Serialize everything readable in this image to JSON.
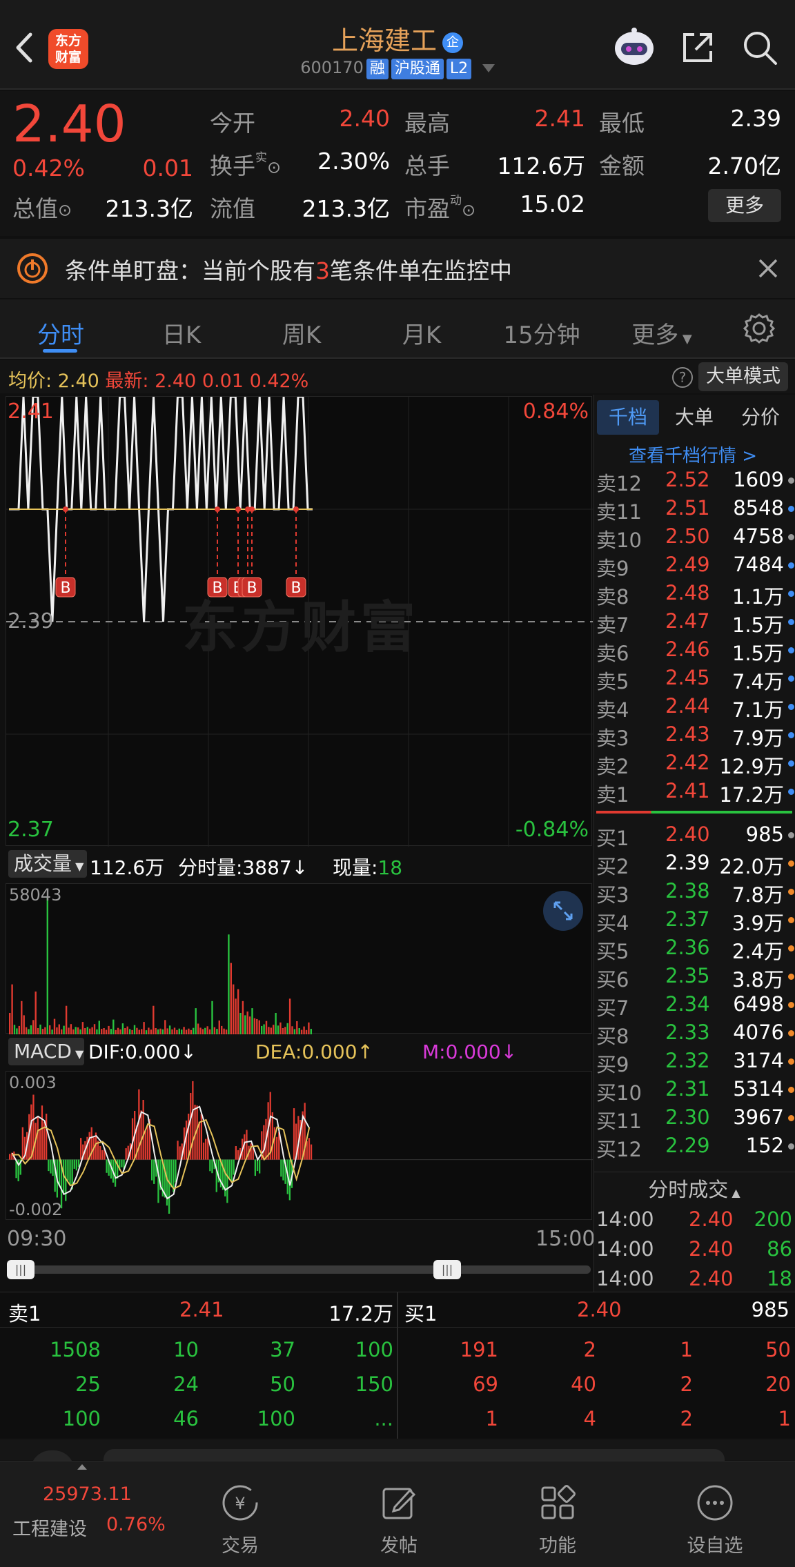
{
  "header": {
    "logo_text": "东方财富",
    "stock_name": "上海建工",
    "qi_badge": "企",
    "code": "600170",
    "tags": [
      "融",
      "沪股通",
      "L2"
    ]
  },
  "quote": {
    "price": "2.40",
    "pct_change": "0.42%",
    "change": "0.01",
    "rows": [
      [
        {
          "label": "今开",
          "value": "2.40",
          "color": "red"
        },
        {
          "label": "最高",
          "value": "2.41",
          "color": "red"
        },
        {
          "label": "最低",
          "value": "2.39",
          "color": "white"
        }
      ],
      [
        {
          "label": "换手",
          "sup": "实",
          "value": "2.30%",
          "color": "white"
        },
        {
          "label": "总手",
          "value": "112.6万",
          "color": "white"
        },
        {
          "label": "金额",
          "value": "2.70亿",
          "color": "white"
        }
      ],
      [
        {
          "label": "总值",
          "value": "213.3亿",
          "color": "white"
        },
        {
          "label": "流值",
          "value": "213.3亿",
          "color": "white"
        },
        {
          "label": "市盈",
          "sup": "动",
          "value": "15.02",
          "color": "white"
        }
      ]
    ],
    "more_label": "更多"
  },
  "banner": {
    "text_before": "条件单盯盘：当前个股有",
    "count": "3",
    "text_after": "笔条件单在监控中"
  },
  "tabs": [
    "分时",
    "日K",
    "周K",
    "月K",
    "15分钟",
    "更多"
  ],
  "active_tab": 0,
  "info_bar": {
    "avg_label": "均价:",
    "avg_value": "2.40",
    "latest_label": "最新:",
    "latest_value": "2.40",
    "change": "0.01",
    "pct": "0.42%",
    "big_order_mode": "大单模式"
  },
  "price_chart": {
    "top_price": "2.41",
    "mid_price": "2.39",
    "bottom_price": "2.37",
    "top_pct": "0.84%",
    "bottom_pct": "-0.84%",
    "watermark": "东方财富",
    "marker_label": "B"
  },
  "volume_bar": {
    "indicator": "成交量",
    "total": "112.6万",
    "tick_label": "分时量:3887↓",
    "now_label": "现量:",
    "now_value": "18",
    "max_label": "58043"
  },
  "macd_bar": {
    "indicator": "MACD",
    "dif": "DIF:0.000↓",
    "dea": "DEA:0.000↑",
    "m": "M:0.000↓",
    "top_label": "0.003",
    "bottom_label": "-0.002"
  },
  "time_axis": {
    "start": "09:30",
    "end": "15:00"
  },
  "order_book": {
    "tabs": [
      "千档",
      "大单",
      "分价"
    ],
    "link": "查看千档行情 >",
    "asks": [
      {
        "label": "卖12",
        "price": "2.52",
        "vol": "1609",
        "dot": "#9a9a9a"
      },
      {
        "label": "卖11",
        "price": "2.51",
        "vol": "8548",
        "dot": "#3f8ef5"
      },
      {
        "label": "卖10",
        "price": "2.50",
        "vol": "4758",
        "dot": "#9a9a9a"
      },
      {
        "label": "卖9",
        "price": "2.49",
        "vol": "7484",
        "dot": "#3f8ef5"
      },
      {
        "label": "卖8",
        "price": "2.48",
        "vol": "1.1万",
        "dot": "#3f8ef5"
      },
      {
        "label": "卖7",
        "price": "2.47",
        "vol": "1.5万",
        "dot": "#3f8ef5"
      },
      {
        "label": "卖6",
        "price": "2.46",
        "vol": "1.5万",
        "dot": "#3f8ef5"
      },
      {
        "label": "卖5",
        "price": "2.45",
        "vol": "7.4万",
        "dot": "#3f8ef5"
      },
      {
        "label": "卖4",
        "price": "2.44",
        "vol": "7.1万",
        "dot": "#3f8ef5"
      },
      {
        "label": "卖3",
        "price": "2.43",
        "vol": "7.9万",
        "dot": "#3f8ef5"
      },
      {
        "label": "卖2",
        "price": "2.42",
        "vol": "12.9万",
        "dot": "#3f8ef5"
      },
      {
        "label": "卖1",
        "price": "2.41",
        "vol": "17.2万",
        "dot": "#3f8ef5"
      }
    ],
    "bids": [
      {
        "label": "买1",
        "price": "2.40",
        "vol": "985",
        "dot": "#9a9a9a",
        "pcolor": "red"
      },
      {
        "label": "买2",
        "price": "2.39",
        "vol": "22.0万",
        "dot": "#f08a2a",
        "pcolor": "white"
      },
      {
        "label": "买3",
        "price": "2.38",
        "vol": "7.8万",
        "dot": "#f08a2a",
        "pcolor": "green"
      },
      {
        "label": "买4",
        "price": "2.37",
        "vol": "3.9万",
        "dot": "#f08a2a",
        "pcolor": "green"
      },
      {
        "label": "买5",
        "price": "2.36",
        "vol": "2.4万",
        "dot": "#f08a2a",
        "pcolor": "green"
      },
      {
        "label": "买6",
        "price": "2.35",
        "vol": "3.8万",
        "dot": "#f08a2a",
        "pcolor": "green"
      },
      {
        "label": "买7",
        "price": "2.34",
        "vol": "6498",
        "dot": "#f08a2a",
        "pcolor": "green"
      },
      {
        "label": "买8",
        "price": "2.33",
        "vol": "4076",
        "dot": "#f08a2a",
        "pcolor": "green"
      },
      {
        "label": "买9",
        "price": "2.32",
        "vol": "3174",
        "dot": "#f08a2a",
        "pcolor": "green"
      },
      {
        "label": "买10",
        "price": "2.31",
        "vol": "5314",
        "dot": "#f08a2a",
        "pcolor": "green"
      },
      {
        "label": "买11",
        "price": "2.30",
        "vol": "3967",
        "dot": "#f08a2a",
        "pcolor": "green"
      },
      {
        "label": "买12",
        "price": "2.29",
        "vol": "152",
        "dot": "#9a9a9a",
        "pcolor": "green"
      }
    ],
    "trades_title": "分时成交",
    "trades": [
      {
        "time": "14:00",
        "price": "2.40",
        "vol": "200"
      },
      {
        "time": "14:00",
        "price": "2.40",
        "vol": "86"
      },
      {
        "time": "14:00",
        "price": "2.40",
        "vol": "18"
      }
    ]
  },
  "level2": {
    "sell_label": "卖1",
    "sell_price": "2.41",
    "sell_vol": "17.2万",
    "buy_label": "买1",
    "buy_price": "2.40",
    "buy_vol": "985",
    "sell_queue": [
      [
        "1508",
        "10",
        "37",
        "100"
      ],
      [
        "25",
        "24",
        "50",
        "150"
      ],
      [
        "100",
        "46",
        "100",
        "..."
      ]
    ],
    "buy_queue": [
      [
        "191",
        "2",
        "1",
        "50"
      ],
      [
        "69",
        "40",
        "2",
        "20"
      ],
      [
        "1",
        "4",
        "2",
        "1"
      ]
    ]
  },
  "nav": {
    "index_value": "25973.11",
    "index_name": "工程建设",
    "index_pct": "0.76%",
    "items": [
      "交易",
      "发帖",
      "功能",
      "设自选"
    ]
  },
  "chart_data": [
    {
      "type": "line",
      "title": "",
      "ylim": [
        2.37,
        2.41
      ],
      "x": [
        "09:30",
        "15:00"
      ],
      "series": [
        {
          "values": [
            2.4,
            2.4,
            2.4,
            2.41,
            2.4,
            2.41,
            2.41,
            2.4,
            2.4,
            2.39,
            2.4,
            2.41,
            2.4,
            2.4,
            2.41,
            2.4,
            2.41,
            2.4,
            2.4,
            2.41,
            2.4,
            2.4,
            2.4,
            2.41,
            2.41,
            2.4,
            2.41,
            2.4,
            2.39,
            2.4,
            2.41,
            2.4,
            2.39,
            2.4,
            2.4,
            2.41,
            2.41,
            2.4,
            2.41,
            2.4,
            2.41,
            2.4,
            2.41,
            2.4,
            2.41,
            2.4,
            2.41,
            2.41,
            2.4,
            2.41,
            2.4,
            2.4,
            2.41,
            2.4,
            2.41,
            2.4,
            2.4,
            2.41,
            2.4,
            2.4,
            2.41,
            2.41,
            2.4,
            2.4
          ]
        },
        {
          "values": [
            2.4,
            2.4,
            2.4,
            2.4,
            2.4,
            2.4,
            2.4,
            2.4,
            2.4,
            2.4,
            2.4,
            2.4,
            2.4,
            2.4,
            2.4,
            2.4,
            2.4,
            2.4,
            2.4,
            2.4,
            2.4,
            2.4,
            2.4,
            2.4,
            2.4,
            2.4,
            2.4,
            2.4,
            2.4,
            2.4,
            2.4,
            2.4,
            2.4,
            2.4,
            2.4,
            2.4,
            2.4,
            2.4,
            2.4,
            2.4,
            2.4,
            2.4,
            2.4,
            2.4,
            2.4,
            2.4,
            2.4,
            2.4,
            2.4,
            2.4,
            2.4,
            2.4,
            2.4,
            2.4,
            2.4,
            2.4,
            2.4,
            2.4,
            2.4,
            2.4,
            2.4,
            2.4,
            2.4,
            2.4
          ]
        }
      ]
    },
    {
      "type": "bar",
      "title": "",
      "ylim": [
        0,
        58043
      ],
      "values": [
        9000,
        21000,
        4000,
        2500,
        3500,
        14000,
        8000,
        3000,
        2200,
        3800,
        6000,
        18000,
        2600,
        4100,
        2300,
        3000,
        58043,
        3800,
        2000,
        6500,
        2900,
        4200,
        2100,
        3600,
        12000,
        2800,
        4300,
        2100,
        3100,
        2900,
        2100,
        5200,
        2600,
        3100,
        2400,
        3000,
        4300,
        2100,
        5700,
        2300,
        2600,
        1900,
        3500,
        2300,
        6200,
        1800,
        2700,
        2100,
        4600,
        2600,
        3300,
        2200,
        1800,
        3900,
        2700,
        1900,
        2200,
        5200,
        1700,
        2800,
        2000,
        12000,
        2600,
        2100,
        2400,
        2100,
        6000,
        2500,
        3700,
        2100,
        2800,
        1800,
        2400,
        2000,
        3100,
        1900,
        2400,
        1800,
        2700,
        11000,
        4500,
        2800,
        2200,
        2700,
        3400,
        2100,
        14000,
        3000,
        2300,
        5800,
        3500,
        2400,
        2000,
        42000,
        30000,
        21000,
        15000,
        19000,
        9000,
        14000,
        8000,
        9600,
        7500,
        11000,
        6800,
        6400,
        5900,
        3500,
        4200,
        5600,
        3100,
        2800,
        4000,
        9000,
        3700,
        5000,
        2600,
        3100,
        4700,
        15000,
        3400,
        2200,
        5500,
        2600,
        1900,
        3300,
        1800,
        5000,
        2300
      ]
    },
    {
      "type": "bar",
      "title": "",
      "ylim": [
        -0.002,
        0.003
      ],
      "values": [
        0.0003,
        -0.0008,
        0.0012,
        0.0024,
        0.0016,
        0.002,
        -0.0006,
        -0.0014,
        -0.0018,
        -0.0011,
        -0.0004,
        0.0008,
        0.0012,
        0.001,
        0.0005,
        -0.0007,
        -0.001,
        -0.0004,
        0.0006,
        0.0018,
        0.0026,
        0.0015,
        -0.0009,
        -0.0016,
        -0.002,
        -0.0012,
        0.0007,
        0.0017,
        0.0029,
        0.002,
        0.0009,
        -0.0005,
        -0.0012,
        -0.0016,
        -0.0008,
        0.0005,
        0.0011,
        0.0006,
        -0.0006,
        0.0015,
        0.0025,
        0.0012,
        -0.0009,
        -0.0015,
        0.0019,
        0.0021,
        0.0008
      ]
    }
  ]
}
